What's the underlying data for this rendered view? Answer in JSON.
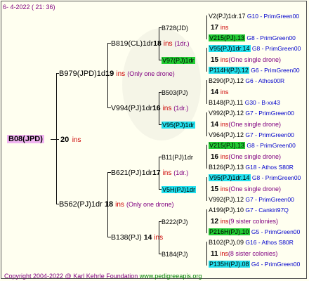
{
  "header": {
    "date": "6-  4-2022 ( 21: 36)"
  },
  "common": {
    "ins": "ins"
  },
  "root": {
    "id": "B08(JPD)",
    "ins_value": "20"
  },
  "l1": {
    "upper": {
      "id": "B979(JPD)1d",
      "ins_value": "19",
      "note": "(Only one drone)"
    },
    "lower": {
      "id": "B562(PJ)1dr",
      "ins_value": "18",
      "note": "(Only one drone)"
    }
  },
  "l2": {
    "a": {
      "id": "B819(CL)1dr",
      "ins_value": "18",
      "note": "(1dr.)"
    },
    "b": {
      "id": "V994(PJ)1dr",
      "ins_value": "16",
      "note": "(1dr.)"
    },
    "c": {
      "id": "B621(PJ)1dr",
      "ins_value": "17",
      "note": "(1dr.)"
    },
    "d": {
      "id": "B138(PJ)",
      "ins_value": "14"
    }
  },
  "l3": [
    {
      "id": "B728(JD)"
    },
    {
      "id": "V97(PJ)1dr"
    },
    {
      "id": "B503(PJ)"
    },
    {
      "id": "V95(PJ)1dr"
    },
    {
      "id": "B11(PJ)1dr"
    },
    {
      "id": "V5H(PJ)1dr"
    },
    {
      "id": "B222(PJ)"
    },
    {
      "id": "B184(PJ)"
    }
  ],
  "l4": [
    {
      "id": "V2(PJ)1dr.17",
      "breed": "G10 - PrimGreen00",
      "hl": "",
      "ins_value": "17",
      "note": ""
    },
    {
      "id": "V215(PJ).13",
      "breed": "G8 - PrimGreen00",
      "hl": "green",
      "ins_value": "",
      "note": ""
    },
    {
      "id": "V95(PJ)1dr.14",
      "breed": "G8 - PrimGreen00",
      "hl": "cyan",
      "ins_value": "15",
      "note": "(One single drone)"
    },
    {
      "id": "P114H(PJ).12",
      "breed": "G6 - PrimGreen00",
      "hl": "cyan",
      "ins_value": "",
      "note": ""
    },
    {
      "id": "B290(PJ).12",
      "breed": "G6 - Athos00R",
      "hl": "",
      "ins_value": "14",
      "note": ""
    },
    {
      "id": "B148(PJ).11",
      "breed": "G30 - B-xx43",
      "hl": "",
      "ins_value": "",
      "note": ""
    },
    {
      "id": "V992(PJ).12",
      "breed": "G7 - PrimGreen00",
      "hl": "",
      "ins_value": "14",
      "note": "(One single drone)"
    },
    {
      "id": "V964(PJ).12",
      "breed": "G7 - PrimGreen00",
      "hl": "",
      "ins_value": "",
      "note": ""
    },
    {
      "id": "V215(PJ).13",
      "breed": "G8 - PrimGreen00",
      "hl": "green",
      "ins_value": "16",
      "note": "(One single drone)"
    },
    {
      "id": "B126(PJ).13",
      "breed": "G18 - Athos S80R",
      "hl": "",
      "ins_value": "",
      "note": ""
    },
    {
      "id": "V95(PJ)1dr.14",
      "breed": "G8 - PrimGreen00",
      "hl": "cyan",
      "ins_value": "15",
      "note": "(One single drone)"
    },
    {
      "id": "V992(PJ).12",
      "breed": "G7 - PrimGreen00",
      "hl": "",
      "ins_value": "",
      "note": ""
    },
    {
      "id": "A199(PJ).10",
      "breed": "G7 - Cankiri97Q",
      "hl": "",
      "ins_value": "12",
      "note": "(9 sister colonies)"
    },
    {
      "id": "P216H(PJ).10",
      "breed": "G5 - PrimGreen00",
      "hl": "green",
      "ins_value": "",
      "note": ""
    },
    {
      "id": "B102(PJ).09",
      "breed": "G16 - Athos S80R",
      "hl": "",
      "ins_value": "11",
      "note": "(8 sister colonies)"
    },
    {
      "id": "P135H(PJ).08",
      "breed": "G4 - PrimGreen00",
      "hl": "cyan",
      "ins_value": "",
      "note": ""
    }
  ],
  "footer": {
    "copyright": "Copyright 2004-2022 @ Karl Kehrle Foundation",
    "site": "www.pedigreeapis.org"
  }
}
